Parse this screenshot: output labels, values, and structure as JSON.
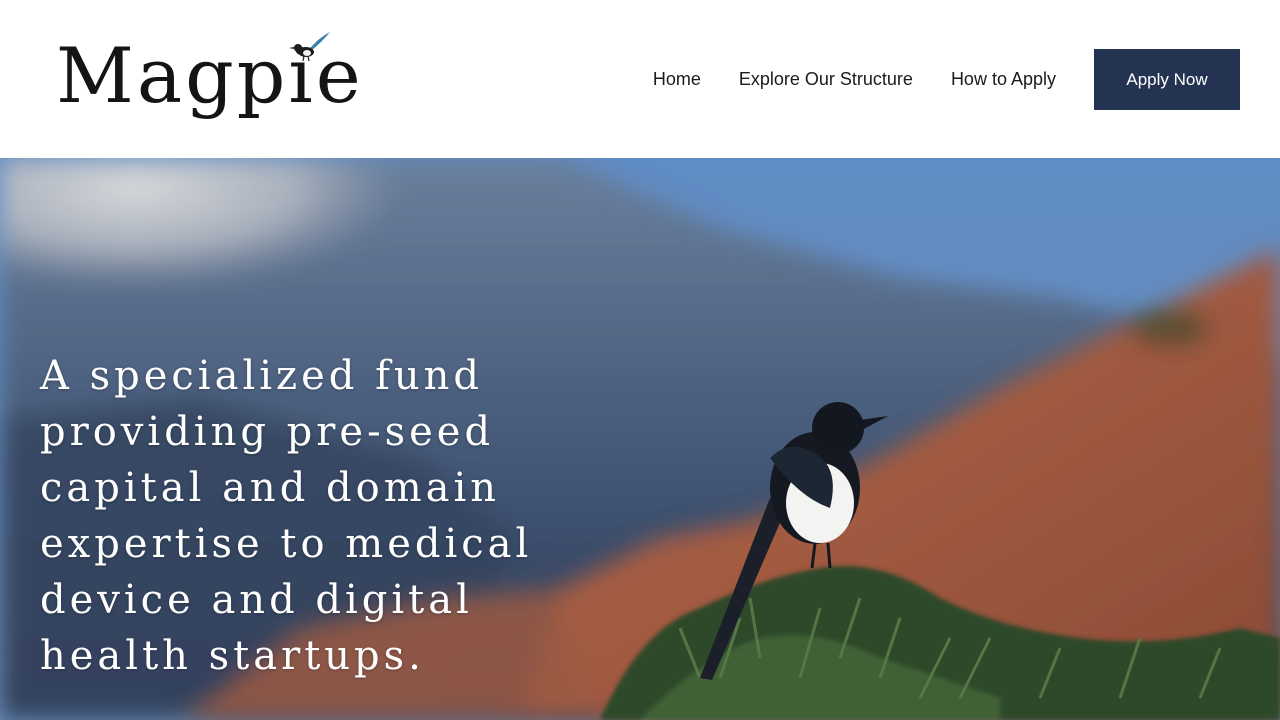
{
  "header": {
    "logo_text": "Magpie",
    "logo_icon": "magpie-bird-icon"
  },
  "nav": {
    "items": [
      {
        "label": "Home"
      },
      {
        "label": "Explore Our Structure"
      },
      {
        "label": "How to Apply"
      }
    ],
    "cta_label": "Apply Now"
  },
  "hero": {
    "headline": "A specialized fund providing pre-seed capital and domain expertise to medical device and digital health startups.",
    "background_image": "magpie-on-shrub-mountain-photo"
  },
  "colors": {
    "cta_background": "#243352",
    "cta_text": "#ffffff",
    "nav_text": "#1b1b1b",
    "headline_text": "#ffffff",
    "header_background": "#ffffff"
  }
}
